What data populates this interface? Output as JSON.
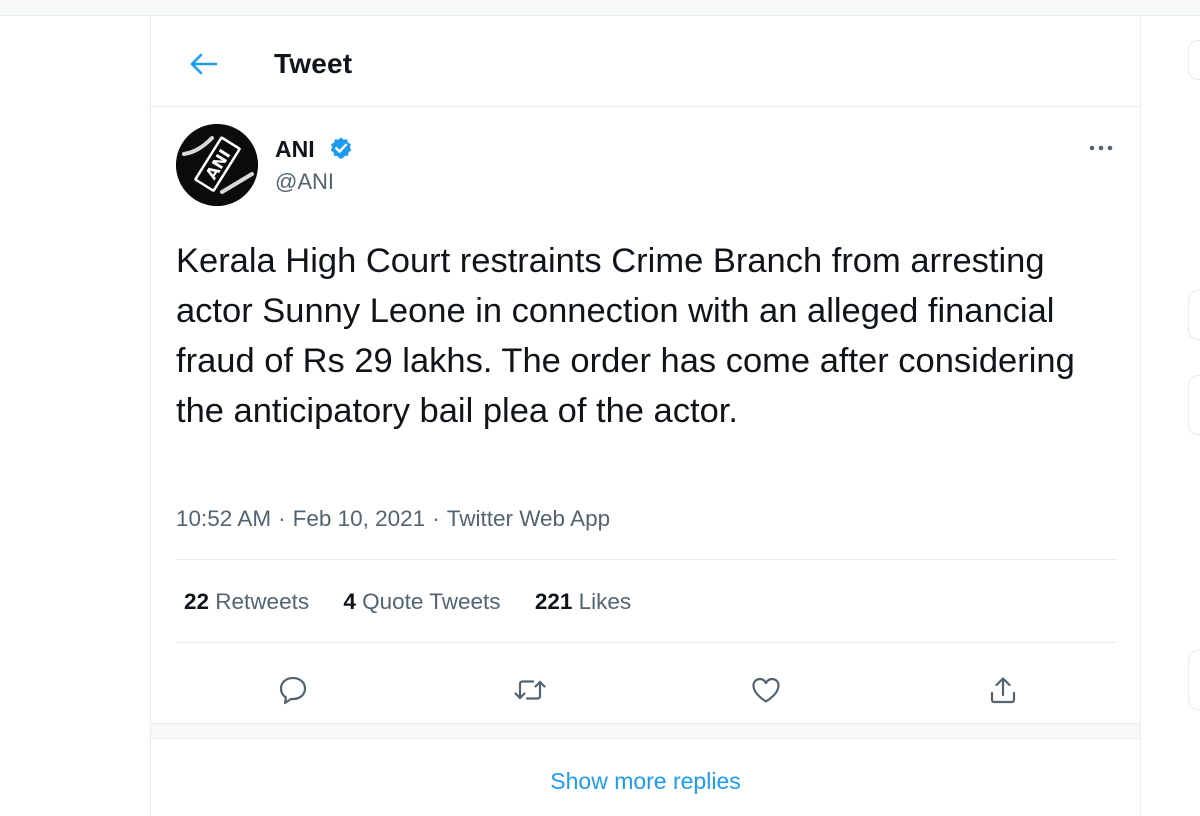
{
  "header": {
    "title": "Tweet",
    "back_icon": "arrow-left-icon",
    "accent_color": "#1d9bf0"
  },
  "tweet": {
    "author": {
      "name": "ANI",
      "handle": "@ANI",
      "verified": true,
      "avatar_text": "ANI"
    },
    "text": "Kerala High Court restraints Crime Branch from arresting actor Sunny Leone in connection with an alleged financial fraud of Rs 29 lakhs. The order has come after considering the anticipatory bail plea of the actor.",
    "time": "10:52 AM",
    "date": "Feb 10, 2021",
    "source": "Twitter Web App",
    "separator": "·",
    "stats": {
      "retweets_count": "22",
      "retweets_label": "Retweets",
      "quotes_count": "4",
      "quotes_label": "Quote Tweets",
      "likes_count": "221",
      "likes_label": "Likes"
    },
    "actions": [
      "reply-icon",
      "retweet-icon",
      "like-icon",
      "share-icon"
    ]
  },
  "show_more_label": "Show more replies",
  "colors": {
    "text_primary": "#0f1419",
    "text_secondary": "#536471",
    "border": "#e6ecf0",
    "verified_blue": "#1d9bf0"
  }
}
